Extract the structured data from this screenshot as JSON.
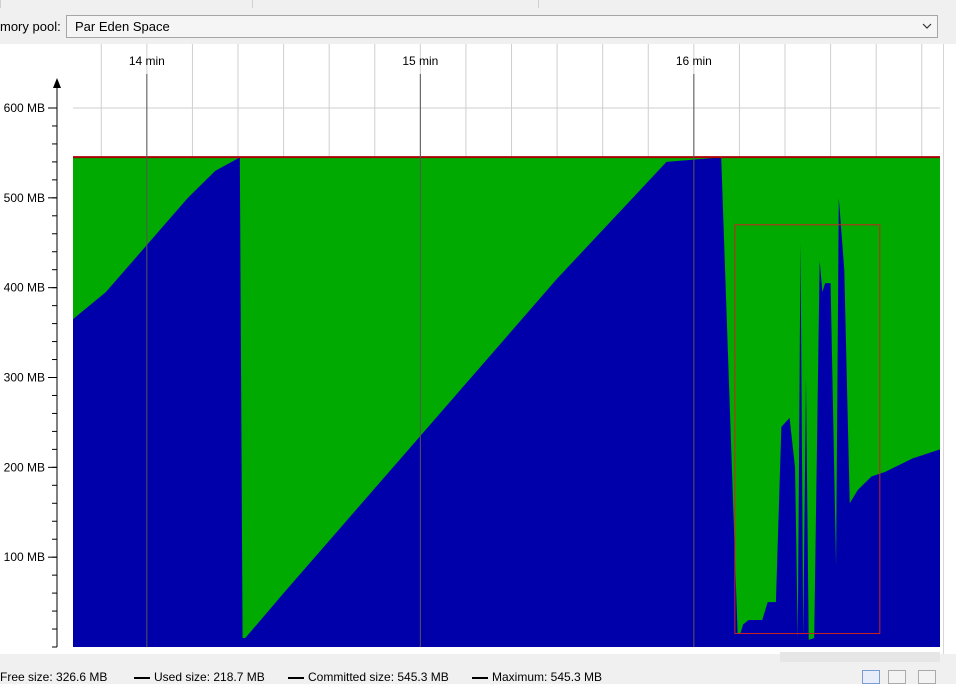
{
  "memory_pool": {
    "label": "mory pool:",
    "selected": "Par Eden Space"
  },
  "legend": {
    "free": "Free size: 326.6 MB",
    "used": "Used size: 218.7 MB",
    "committed": "Committed size: 545.3 MB",
    "maximum": "Maximum: 545.3 MB"
  },
  "colors": {
    "used": "#0000aa",
    "free": "#00aa00",
    "committed_line": "#aa0000",
    "highlight_box": "#cc2222"
  },
  "chart_data": {
    "type": "area",
    "xlabel": "",
    "ylabel": "",
    "x_unit": "min",
    "xlim": [
      13.73,
      16.9
    ],
    "ylim": [
      0,
      600
    ],
    "x_ticks": [
      {
        "value": 14,
        "label": "14 min"
      },
      {
        "value": 15,
        "label": "15 min"
      },
      {
        "value": 16,
        "label": "16 min"
      }
    ],
    "y_ticks": [
      {
        "value": 100,
        "label": "100 MB"
      },
      {
        "value": 200,
        "label": "200 MB"
      },
      {
        "value": 300,
        "label": "300 MB"
      },
      {
        "value": 400,
        "label": "400 MB"
      },
      {
        "value": 500,
        "label": "500 MB"
      },
      {
        "value": 600,
        "label": "600 MB"
      }
    ],
    "grid": true,
    "legend_position": "bottom",
    "committed_MB": 545.3,
    "series": [
      {
        "name": "Used size",
        "x": [
          13.73,
          13.85,
          13.95,
          14.05,
          14.15,
          14.25,
          14.34,
          14.35,
          14.36,
          14.5,
          14.7,
          14.9,
          15.1,
          15.3,
          15.5,
          15.7,
          15.9,
          16.1,
          16.16,
          16.17,
          16.18,
          16.2,
          16.25,
          16.27,
          16.3,
          16.32,
          16.35,
          16.37,
          16.38,
          16.39,
          16.4,
          16.41,
          16.42,
          16.44,
          16.46,
          16.47,
          16.48,
          16.5,
          16.52,
          16.53,
          16.55,
          16.57,
          16.58,
          16.6,
          16.65,
          16.7,
          16.8,
          16.9
        ],
        "values": [
          365,
          395,
          430,
          465,
          500,
          530,
          545,
          10,
          10,
          60,
          130,
          200,
          270,
          340,
          410,
          475,
          540,
          545,
          15,
          15,
          25,
          30,
          30,
          50,
          50,
          245,
          255,
          200,
          8,
          450,
          10,
          300,
          8,
          10,
          430,
          395,
          405,
          405,
          90,
          500,
          420,
          160,
          165,
          175,
          190,
          195,
          210,
          220
        ]
      },
      {
        "name": "Free size",
        "note_source": "area between Used size and Committed size"
      }
    ]
  }
}
